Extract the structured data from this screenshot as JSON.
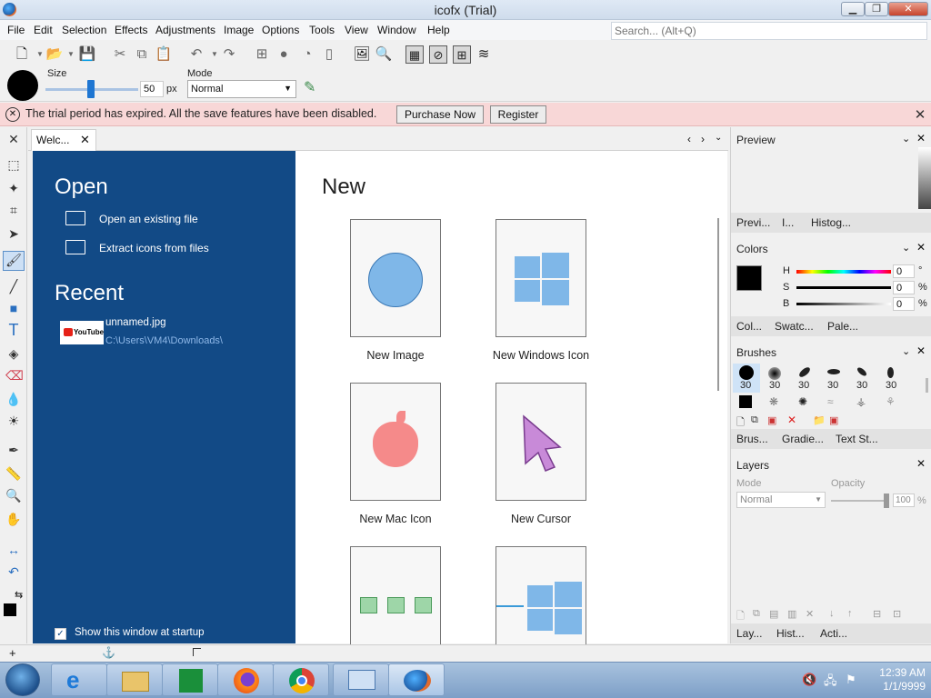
{
  "window": {
    "title": "icofx (Trial)",
    "minimize": "▁",
    "maximize": "❐",
    "close": "✕"
  },
  "menu": [
    "File",
    "Edit",
    "Selection",
    "Effects",
    "Adjustments",
    "Image",
    "Options",
    "Tools",
    "View",
    "Window",
    "Help"
  ],
  "search": {
    "placeholder": "Search... (Alt+Q)"
  },
  "toolopts": {
    "size_label": "Size",
    "size_value": "50",
    "size_unit": "px",
    "size_fraction": 0.5,
    "mode_label": "Mode",
    "mode_value": "Normal"
  },
  "trial": {
    "message": "The trial period has expired. All the save features have been disabled.",
    "purchase": "Purchase Now",
    "register": "Register"
  },
  "tabs": {
    "welcome": "Welc..."
  },
  "welcome": {
    "open_title": "Open",
    "open_existing": "Open an existing file",
    "extract_icons": "Extract icons from files",
    "recent_title": "Recent",
    "recent_item": {
      "name": "unnamed.jpg",
      "path": "C:\\Users\\VM4\\Downloads\\",
      "thumb": "YouTube"
    },
    "startup_checkbox": "Show this window at startup",
    "new_title": "New",
    "new_items": [
      "New Image",
      "New Windows Icon",
      "New Mac Icon",
      "New Cursor"
    ]
  },
  "panels": {
    "preview": {
      "title": "Preview",
      "tabs": [
        "Previ...",
        "I...",
        "Histog..."
      ]
    },
    "colors": {
      "title": "Colors",
      "h_label": "H",
      "s_label": "S",
      "b_label": "B",
      "h_val": "0",
      "s_val": "0",
      "b_val": "0",
      "deg": "°",
      "pct": "%",
      "tabs": [
        "Col...",
        "Swatc...",
        "Pale..."
      ]
    },
    "brushes": {
      "title": "Brushes",
      "sizes": [
        "30",
        "30",
        "30",
        "30",
        "30",
        "30"
      ],
      "tabs": [
        "Brus...",
        "Gradie...",
        "Text St..."
      ]
    },
    "layers": {
      "title": "Layers",
      "mode_label": "Mode",
      "opacity_label": "Opacity",
      "mode_value": "Normal",
      "opacity_value": "100",
      "pct": "%",
      "tabs": [
        "Lay...",
        "Hist...",
        "Acti..."
      ]
    }
  },
  "clock": {
    "time": "12:39 AM",
    "date": "1/1/9999"
  },
  "colors": {
    "accent_blue": "#124a86",
    "trial_bg": "#f8d7d7"
  }
}
